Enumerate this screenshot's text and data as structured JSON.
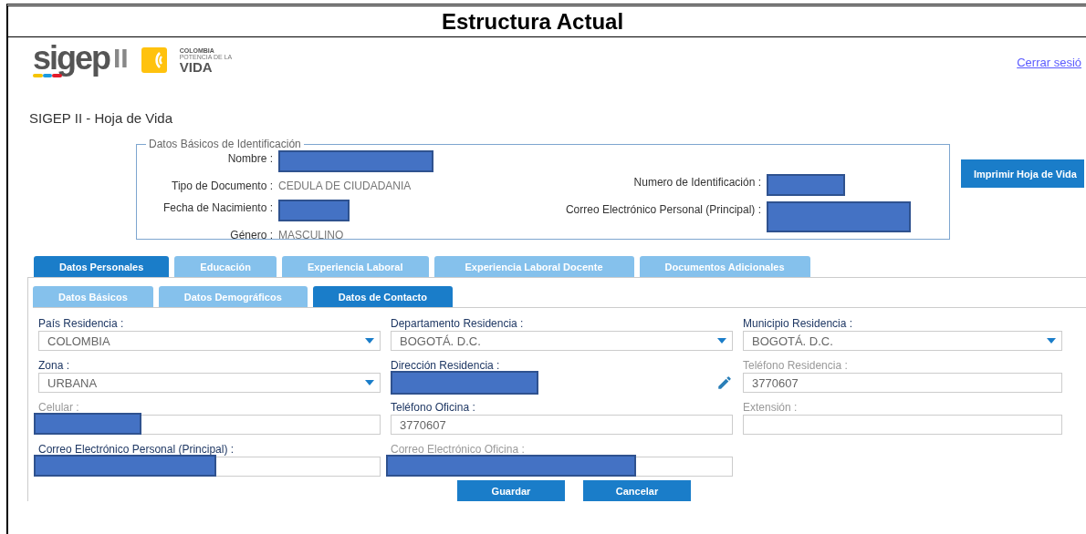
{
  "document": {
    "heading": "Estructura Actual"
  },
  "header": {
    "logo": {
      "brand": "sigep",
      "suffix": "II",
      "country": "COLOMBIA",
      "tagline": "POTENCIA DE LA",
      "word": "VIDA"
    },
    "logout_link": "Cerrar sesió"
  },
  "page_title": "SIGEP II - Hoja de Vida",
  "identification": {
    "legend": "Datos Básicos de Identificación",
    "left": [
      {
        "label": "Nombre :",
        "redacted": true
      },
      {
        "label": "Tipo de Documento :",
        "value": "CEDULA DE CIUDADANIA",
        "redacted": false
      },
      {
        "label": "Fecha de Nacimiento :",
        "redacted": true
      },
      {
        "label": "Género :",
        "value": "MASCULINO",
        "redacted": false
      }
    ],
    "right": [
      {
        "label": "Numero de Identificación :",
        "redacted": true
      },
      {
        "label": "Correo Electrónico Personal (Principal) :",
        "redacted": true
      }
    ]
  },
  "print_button": "Imprimir Hoja de Vida",
  "tabs": [
    {
      "label": "Datos Personales",
      "selected": true
    },
    {
      "label": "Educación",
      "selected": false
    },
    {
      "label": "Experiencia Laboral",
      "selected": false
    },
    {
      "label": "Experiencia Laboral Docente",
      "selected": false
    },
    {
      "label": "Documentos Adicionales",
      "selected": false
    }
  ],
  "subtabs": [
    {
      "label": "Datos Básicos",
      "selected": false
    },
    {
      "label": "Datos Demográficos",
      "selected": false
    },
    {
      "label": "Datos de Contacto",
      "selected": true
    }
  ],
  "fields": [
    {
      "label": "País Residencia :",
      "kind": "select",
      "value": "COLOMBIA",
      "disabled": false
    },
    {
      "label": "Departamento Residencia :",
      "kind": "select",
      "value": "BOGOTÁ. D.C.",
      "disabled": false
    },
    {
      "label": "Municipio Residencia :",
      "kind": "select",
      "value": "BOGOTÁ. D.C.",
      "disabled": false
    },
    {
      "label": "Zona :",
      "kind": "select",
      "value": "URBANA",
      "disabled": false
    },
    {
      "label": "Dirección Residencia :",
      "kind": "address",
      "disabled": false,
      "redacted": true
    },
    {
      "label": "Teléfono Residencia :",
      "kind": "input",
      "value": "3770607",
      "disabled": true,
      "redacted": false
    },
    {
      "label": "Celular :",
      "kind": "input",
      "disabled": true,
      "redacted": true
    },
    {
      "label": "Teléfono Oficina :",
      "kind": "input",
      "value": "3770607",
      "disabled": false,
      "redacted": false
    },
    {
      "label": "Extensión :",
      "kind": "input",
      "disabled": true,
      "redacted": false
    },
    {
      "label": "Correo Electrónico Personal (Principal) :",
      "kind": "input",
      "disabled": false,
      "redacted": true
    },
    {
      "label": "Correo Electrónico Oficina :",
      "kind": "input",
      "disabled": true,
      "redacted": true
    }
  ],
  "actions": [
    "Guardar",
    "Cancelar"
  ]
}
